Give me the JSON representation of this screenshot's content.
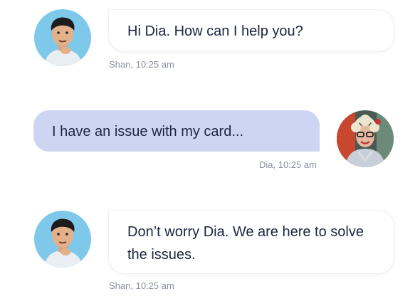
{
  "messages": [
    {
      "sender": "Shan",
      "avatar": "male-user-avatar",
      "text": "Hi Dia. How can I help you?",
      "meta": "Shan, 10:25 am"
    },
    {
      "sender": "Dia",
      "avatar": "female-user-avatar",
      "text": "I have an issue with my card...",
      "meta": "Dia, 10:25 am"
    },
    {
      "sender": "Shan",
      "avatar": "male-user-avatar",
      "text": "Don’t worry Dia. We are here to solve the issues.",
      "meta": "Shan, 10:25 am"
    }
  ],
  "colors": {
    "incoming_bubble": "#ffffff",
    "outgoing_bubble": "#ccd6f3",
    "avatar_bg_shan": "#7ec8ea",
    "text": "#1f2540",
    "meta_text": "#8b90a0"
  }
}
